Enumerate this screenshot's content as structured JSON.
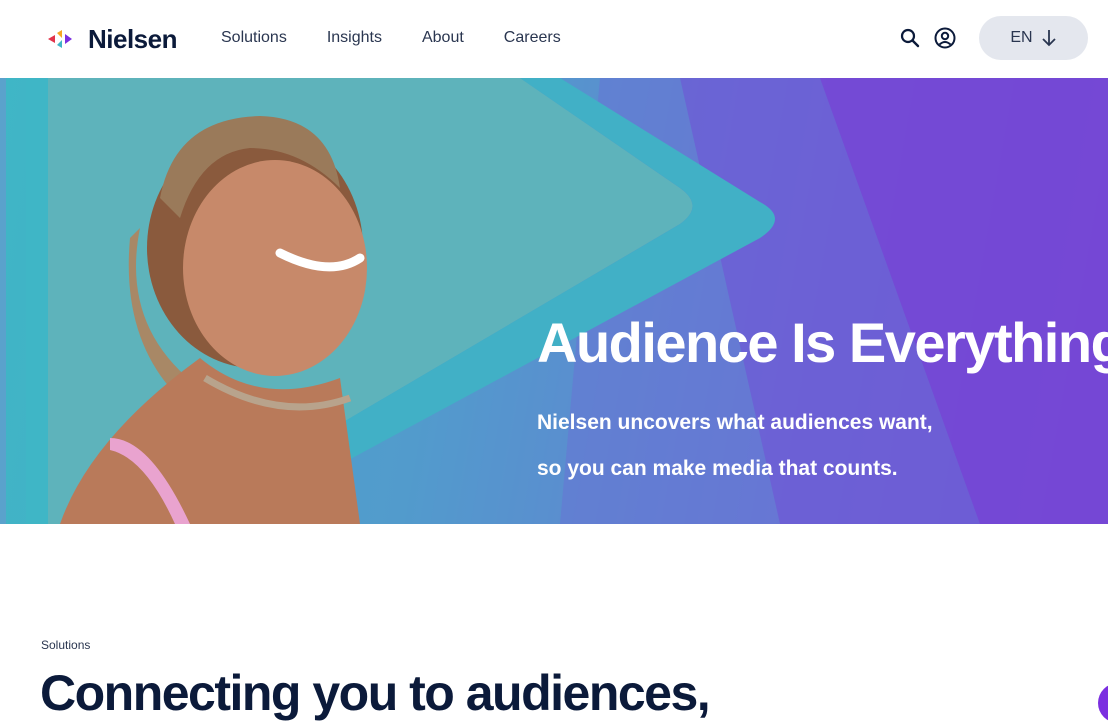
{
  "brand": {
    "name": "Nielsen"
  },
  "nav": {
    "items": [
      {
        "label": "Solutions"
      },
      {
        "label": "Insights"
      },
      {
        "label": "About"
      },
      {
        "label": "Careers"
      }
    ]
  },
  "header_actions": {
    "search_icon": "search-icon",
    "account_icon": "user-circle-icon",
    "language_label": "EN",
    "language_icon": "arrow-down-icon"
  },
  "hero": {
    "title": "Audience Is Everything",
    "subtitle_lines": [
      "Nielsen uncovers what audiences want,",
      "so you can make media that counts."
    ]
  },
  "solutions": {
    "label": "Solutions",
    "heading": "Connecting you to audiences,"
  },
  "colors": {
    "brand_navy": "#0b1a3a",
    "hero_teal": "#3fb6c6",
    "hero_purple": "#7e3ed8",
    "lang_button_bg": "#e4e7ee"
  }
}
